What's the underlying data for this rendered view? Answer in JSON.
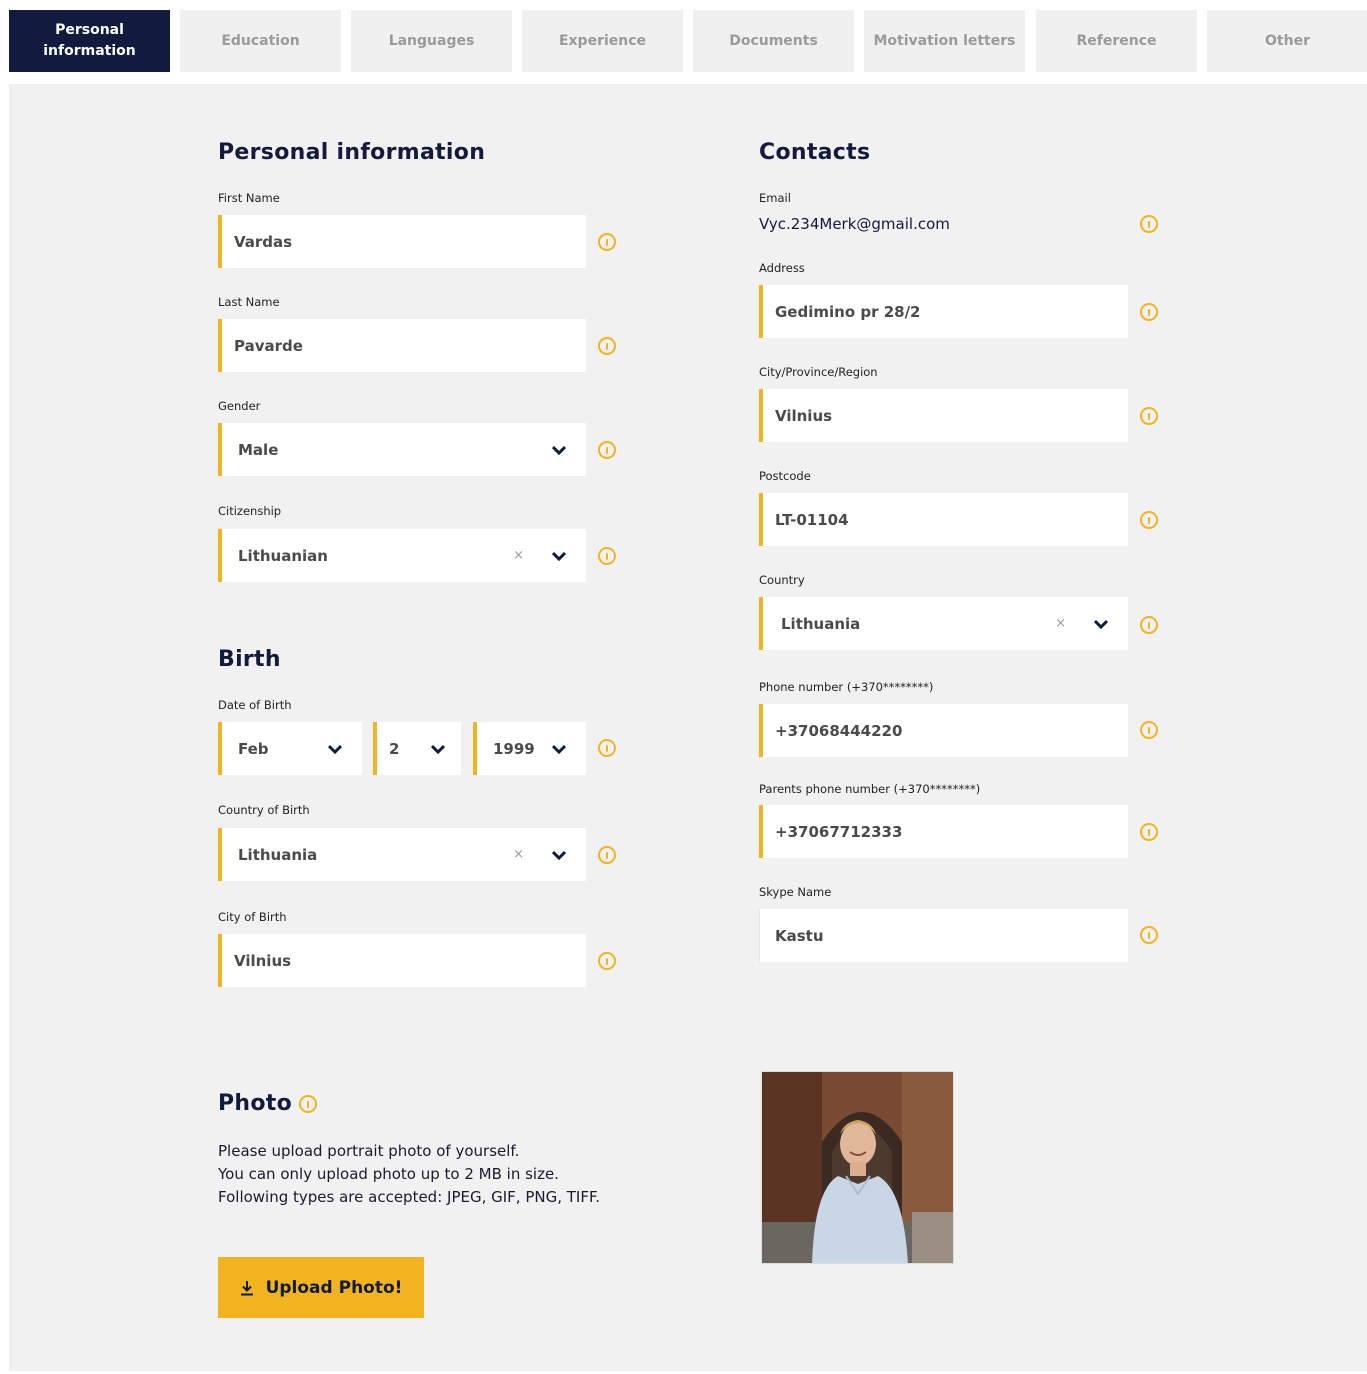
{
  "tabs": [
    {
      "label": "Personal information",
      "active": true
    },
    {
      "label": "Education",
      "active": false
    },
    {
      "label": "Languages",
      "active": false
    },
    {
      "label": "Experience",
      "active": false
    },
    {
      "label": "Documents",
      "active": false
    },
    {
      "label": "Motivation letters",
      "active": false
    },
    {
      "label": "Reference",
      "active": false
    },
    {
      "label": "Other",
      "active": false
    }
  ],
  "personal": {
    "title": "Personal information",
    "first_name": {
      "label": "First Name",
      "value": "Vardas"
    },
    "last_name": {
      "label": "Last Name",
      "value": "Pavarde"
    },
    "gender": {
      "label": "Gender",
      "value": "Male"
    },
    "citizenship": {
      "label": "Citizenship",
      "value": "Lithuanian"
    }
  },
  "birth": {
    "title": "Birth",
    "date_label": "Date of Birth",
    "month": "Feb",
    "day": "2",
    "year": "1999",
    "country": {
      "label": "Country of Birth",
      "value": "Lithuania"
    },
    "city": {
      "label": "City of Birth",
      "value": "Vilnius"
    }
  },
  "contacts": {
    "title": "Contacts",
    "email": {
      "label": "Email",
      "value": "Vyc.234Merk@gmail.com"
    },
    "address": {
      "label": "Address",
      "value": "Gedimino pr 28/2"
    },
    "city": {
      "label": "City/Province/Region",
      "value": "Vilnius"
    },
    "postcode": {
      "label": "Postcode",
      "value": "LT-01104"
    },
    "country": {
      "label": "Country",
      "value": "Lithuania"
    },
    "phone": {
      "label": "Phone number (+370********)",
      "value": "+37068444220"
    },
    "parents_phone": {
      "label": "Parents phone number (+370********)",
      "value": "+37067712333"
    },
    "skype": {
      "label": "Skype Name",
      "value": "Kastu"
    }
  },
  "photo": {
    "title": "Photo",
    "line1": "Please upload portrait photo of yourself.",
    "line2": "You can only upload photo up to 2 MB in size.",
    "line3": "Following types are accepted: JPEG, GIF, PNG, TIFF.",
    "button_label": "Upload Photo!"
  },
  "icons": {
    "info": "info-icon",
    "chevron": "chevron-down-icon",
    "clear": "clear-icon",
    "upload": "download-arrow-icon"
  },
  "clear_symbol": "×",
  "colors": {
    "accent": "#f2b320",
    "navy": "#121a3e",
    "panel": "#f1f1f1"
  }
}
